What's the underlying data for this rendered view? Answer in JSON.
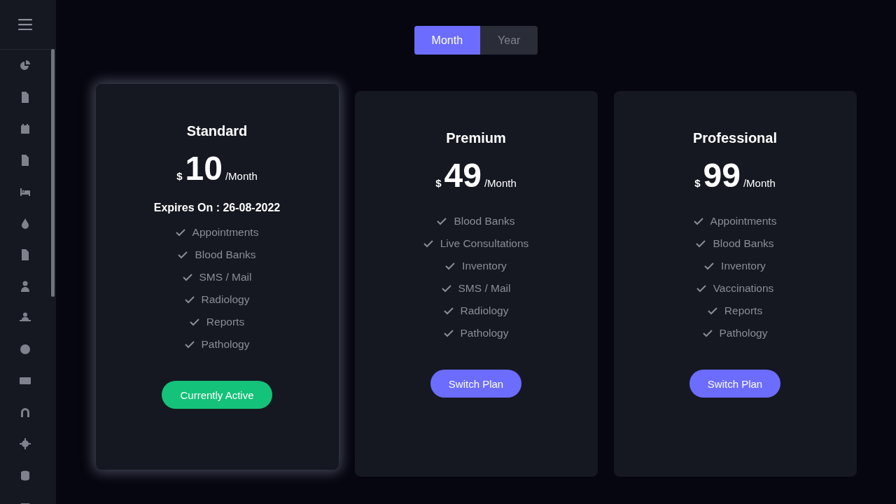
{
  "billing_toggle": [
    {
      "label": "Month",
      "selected": true
    },
    {
      "label": "Year",
      "selected": false
    }
  ],
  "plans": [
    {
      "name": "Standard",
      "currency": "$",
      "amount": "10",
      "period": "/Month",
      "selected": true,
      "expires": "Expires On : 26-08-2022",
      "features": [
        "Appointments",
        "Blood Banks",
        "SMS / Mail",
        "Radiology",
        "Reports",
        "Pathology"
      ],
      "button": {
        "label": "Currently Active",
        "kind": "active"
      }
    },
    {
      "name": "Premium",
      "currency": "$",
      "amount": "49",
      "period": "/Month",
      "selected": false,
      "features": [
        "Blood Banks",
        "Live Consultations",
        "Inventory",
        "SMS / Mail",
        "Radiology",
        "Pathology"
      ],
      "button": {
        "label": "Switch Plan",
        "kind": "switch"
      }
    },
    {
      "name": "Professional",
      "currency": "$",
      "amount": "99",
      "period": "/Month",
      "selected": false,
      "features": [
        "Appointments",
        "Blood Banks",
        "Inventory",
        "Vaccinations",
        "Reports",
        "Pathology"
      ],
      "button": {
        "label": "Switch Plan",
        "kind": "switch"
      }
    }
  ]
}
